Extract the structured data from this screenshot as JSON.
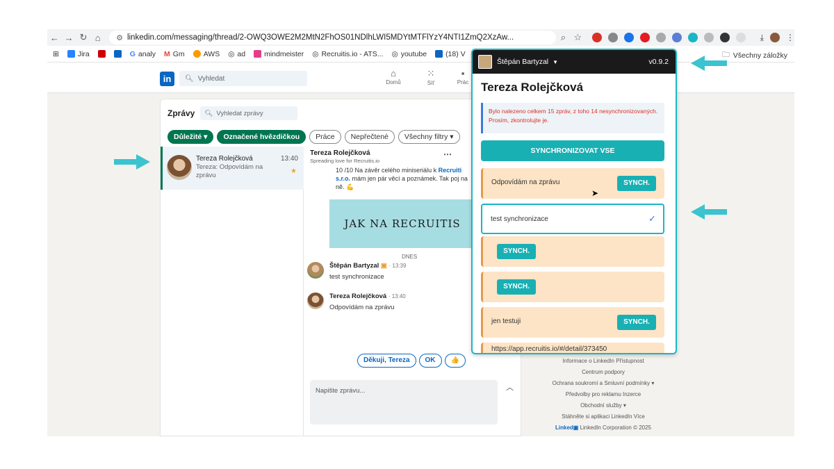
{
  "browser": {
    "url": "linkedin.com/messaging/thread/2-OWQ3OWE2M2MtN2FhOS01NDlhLWI5MDYtMTFlYzY4NTI1ZmQ2XzAw...",
    "bookmarks": [
      "Jira",
      "in",
      "analy",
      "Gm",
      "AWS",
      "ad",
      "mindmeister",
      "Recruitis.io - ATS...",
      "youtube",
      "(18) V"
    ],
    "all_bookmarks": "Všechny záložky"
  },
  "linkedin": {
    "search_placeholder": "Vyhledat",
    "nav": [
      "Domů",
      "Síť",
      "Prác"
    ],
    "messaging_title": "Zprávy",
    "msg_search_placeholder": "Vyhledat zprávy",
    "filters": [
      "Důležité ▾",
      "Označené hvězdičkou",
      "Práce",
      "Nepřečtené",
      "Všechny filtry ▾"
    ],
    "conversation": {
      "name": "Tereza Rolejčková",
      "time": "13:40",
      "preview": "Tereza: Odpovídám na zprávu"
    },
    "thread": {
      "name": "Tereza Rolejčková",
      "subtitle": "Spreading love for Recruitis.io",
      "old_message_pre": "10 /10 Na závěr celého miniseriálu k ",
      "old_message_link": "Recruiti s.r.o.",
      "old_message_post": " mám jen pár věcí a poznámek. Tak poj na ně. 💪",
      "banner": "JAK NA RECRUITIS",
      "day": "DNES",
      "messages": [
        {
          "author": "Štěpán Bartyzal",
          "time": "· 13:39",
          "text": "test synchronizace"
        },
        {
          "author": "Tereza Rolejčková",
          "time": "· 13:40",
          "text": "Odpovídám na zprávu"
        }
      ],
      "quick_replies": [
        "Děkuji, Tereza",
        "OK",
        "👍"
      ],
      "compose_placeholder": "Napište zprávu..."
    },
    "footer": [
      "Informace o LinkedIn   Přístupnost",
      "Centrum podpory",
      "Ochrana soukromí a Smluvní podmínky ▾",
      "Předvolby pro reklamu   Inzerce",
      "Obchodní služby ▾",
      "Stáhněte si aplikaci LinkedIn   Více"
    ],
    "footer_brand": "LinkedIn Corporation © 2025"
  },
  "extension": {
    "user": "Štěpán Bartyzal",
    "version": "v0.9.2",
    "contact_name": "Tereza Rolejčková",
    "alert": "Bylo nalezeno celkem 15 zpráv, z toho 14 nesynchronizovaných. Prosím, zkontrolujte je.",
    "sync_all": "SYNCHRONIZOVAT VSE",
    "sync_label": "SYNCH.",
    "items": [
      {
        "text": "Odpovídám na zprávu"
      },
      {
        "text": "test synchronizace"
      },
      {
        "text": ""
      },
      {
        "text": ""
      },
      {
        "text": "jen testuji"
      },
      {
        "text": "https://app.recruitis.io/#/detail/373450"
      }
    ],
    "accent": "#19b6c6"
  }
}
